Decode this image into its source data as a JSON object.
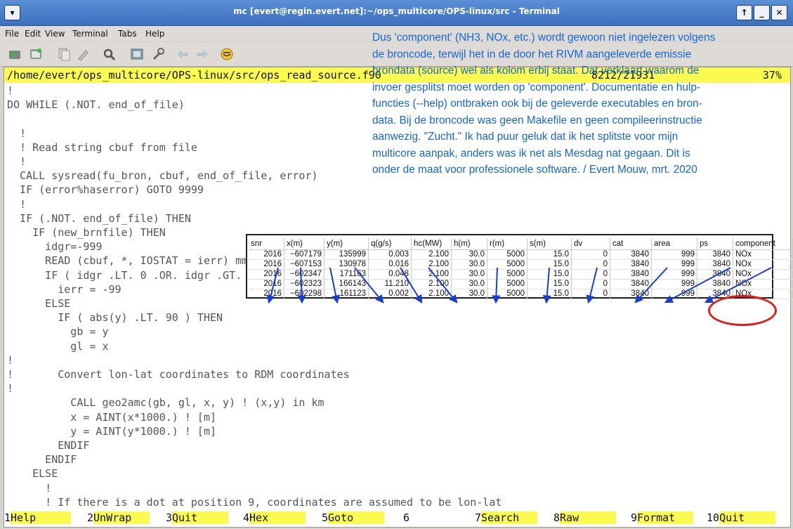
{
  "window": {
    "title": "mc [evert@regin.evert.net]:~/ops_multicore/OPS-linux/src - Terminal",
    "menu": [
      "File",
      "Edit",
      "View",
      "Terminal",
      "Tabs",
      "Help"
    ]
  },
  "toolbar": {
    "icons": [
      "new-tab-icon",
      "new-window-icon",
      "copy-icon",
      "paste-icon",
      "find-icon",
      "fullscreen-icon",
      "preferences-icon",
      "back-icon",
      "forward-icon",
      "smiley-icon"
    ]
  },
  "editor": {
    "path": "/home/evert/ops_multicore/OPS-linux/src/ops_read_source.f90",
    "position": "8212/21931",
    "percent": "37%",
    "lines": [
      "!",
      "DO WHILE (.NOT. end_of_file)",
      "",
      "  !",
      "  ! Read string cbuf from file",
      "  !",
      "  CALL sysread(fu_bron, cbuf, end_of_file, error)",
      "  IF (error%haserror) GOTO 9999",
      "  !",
      "  IF (.NOT. end_of_file) THEN",
      "    IF (new_brnfile) THEN",
      "      idgr=-999",
      "      READ (cbuf, *, IOSTAT = ierr) mm, x, y, qob, qww, hbron, diameter, szopp, ibtg, ibroncat, iland, idgr",
      "      IF ( idgr .LT. 0 .OR. idgr .GT. MAXDIST ) THEN",
      "        ierr = -99",
      "      ELSE",
      "        IF ( abs(y) .LT. 90 ) THEN",
      "          gb = y",
      "          gl = x",
      "!",
      "!       Convert lon-lat coordinates to RDM coordinates",
      "!",
      "          CALL geo2amc(gb, gl, x, y) ! (x,y) in km",
      "          x = AINT(x*1000.) ! [m]",
      "          y = AINT(y*1000.) ! [m]",
      "        ENDIF",
      "      ENDIF",
      "    ELSE",
      "      !",
      "      ! If there is a dot at position 9, coordinates are assumed to be lon-lat"
    ],
    "fkeys": [
      {
        "num": "1",
        "label": "Help"
      },
      {
        "num": "2",
        "label": "UnWrap"
      },
      {
        "num": "3",
        "label": "Quit"
      },
      {
        "num": "4",
        "label": "Hex"
      },
      {
        "num": "5",
        "label": "Goto"
      },
      {
        "num": "6",
        "label": ""
      },
      {
        "num": "7",
        "label": "Search"
      },
      {
        "num": "8",
        "label": "Raw"
      },
      {
        "num": "9",
        "label": "Format"
      },
      {
        "num": "10",
        "label": "Quit"
      }
    ]
  },
  "note": {
    "lines": [
      "Dus 'component' (NH3, NOx, etc.) wordt gewoon niet ingelezen volgens",
      "de broncode, terwijl het in de door het RIVM aangeleverde emissie",
      "brondata (source) wel als kolom erbij staat. Dat verklaart waarom de",
      "invoer gesplitst moet worden op 'component'. Documentatie en hulp-",
      "functies (--help) ontbraken ook bij de geleverde executables en bron-",
      "data. Bij de broncode was geen Makefile en geen compileerinstructie",
      "aanwezig. \"Zucht.\" Ik had puur geluk dat ik het splitste voor mijn",
      "multicore aanpak, anders was ik net als Mesdag nat gegaan. Dit is",
      "onder de maat voor professionele software.  / Evert Mouw, mrt. 2020"
    ],
    "color": "#1565d8"
  },
  "sheet": {
    "headers": [
      "snr",
      "x(m)",
      "y(m)",
      "q(g/s)",
      "hc(MW)",
      "h(m)",
      "r(m)",
      "s(m)",
      "dv",
      "cat",
      "area",
      "ps",
      "component"
    ],
    "rows": [
      [
        "2016",
        "−607179",
        "135999",
        "0.003",
        "2.100",
        "30.0",
        "5000",
        "15.0",
        "0",
        "3840",
        "999",
        "3840",
        "NOx"
      ],
      [
        "2016",
        "−607153",
        "130978",
        "0.016",
        "2.100",
        "30.0",
        "5000",
        "15.0",
        "0",
        "3840",
        "999",
        "3840",
        "NOx"
      ],
      [
        "2016",
        "−602347",
        "171163",
        "0.048",
        "2.100",
        "30.0",
        "5000",
        "15.0",
        "0",
        "3840",
        "999",
        "3840",
        "NOx"
      ],
      [
        "2016",
        "−602323",
        "166143",
        "11.210",
        "2.100",
        "30.0",
        "5000",
        "15.0",
        "0",
        "3840",
        "999",
        "3840",
        "NOx"
      ],
      [
        "2016",
        "−602298",
        "161123",
        "0.002",
        "2.100",
        "30.0",
        "5000",
        "15.0",
        "0",
        "3840",
        "999",
        "3840",
        "NOx"
      ]
    ],
    "highlight_color": "#e21b1b",
    "arrow_color": "#1a3fd0"
  }
}
